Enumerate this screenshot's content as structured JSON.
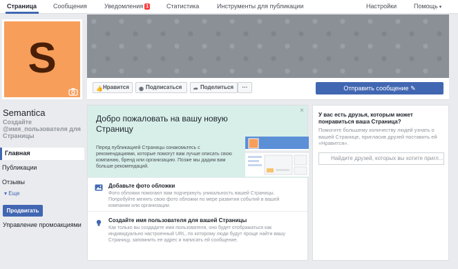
{
  "nav": {
    "tabs": [
      {
        "label": "Страница"
      },
      {
        "label": "Сообщения"
      },
      {
        "label": "Уведомления",
        "badge": "1"
      },
      {
        "label": "Статистика"
      },
      {
        "label": "Инструменты для публикации"
      }
    ],
    "settings": "Настройки",
    "help": "Помощь"
  },
  "page": {
    "avatar_letter": "S",
    "name": "Semantica",
    "create_username": "Создайте @имя_пользователя для Страницы"
  },
  "sidebar": {
    "items": [
      "Главная",
      "Публикации",
      "Отзывы"
    ],
    "more": "Еще",
    "promote": "Продвигать",
    "manage_promos": "Управление промоакциями"
  },
  "actions": {
    "like": "Нравится",
    "subscribe": "Подписаться",
    "share": "Поделиться",
    "more": "···",
    "send_message": "Отправить сообщение"
  },
  "welcome": {
    "title": "Добро пожаловать на вашу новую Страницу",
    "desc": "Перед публикацией Страницы ознакомьтесь с рекомендациями, которые помогут вам лучше описать свою компанию, бренд или организацию. Позже мы дадим вам больше рекомендаций.",
    "close": "×",
    "suggestions": [
      {
        "title": "Добавьте фото обложки",
        "desc": "Фото обложки помогают вам подчеркнуть уникальность вашей Страницы. Попробуйте менять свою фото обложки по мере развития событий в вашей компании или организации."
      },
      {
        "title": "Создайте имя пользователя для вашей Страницы",
        "desc": "Как только вы создадите имя пользователя, оно будет отображаться как индивидуально настроенный URL, по которому люди будут проще найти вашу Страницу, запомнить ее адрес и написать ей сообщение."
      }
    ]
  },
  "friends": {
    "title": "У вас есть друзья, которым может понравиться ваша Страница?",
    "desc": "Помогите большему количеству людей узнать о вашей Странице, пригласив друзей поставить ей «Нравится».",
    "search_placeholder": "Найдите друзей, которых вы хотите пригл..."
  },
  "colors": {
    "brand": "#4267b2",
    "avatar_bg": "#f79e5a",
    "welcome_bg": "#d8efe9",
    "badge": "#fa3e3e"
  }
}
